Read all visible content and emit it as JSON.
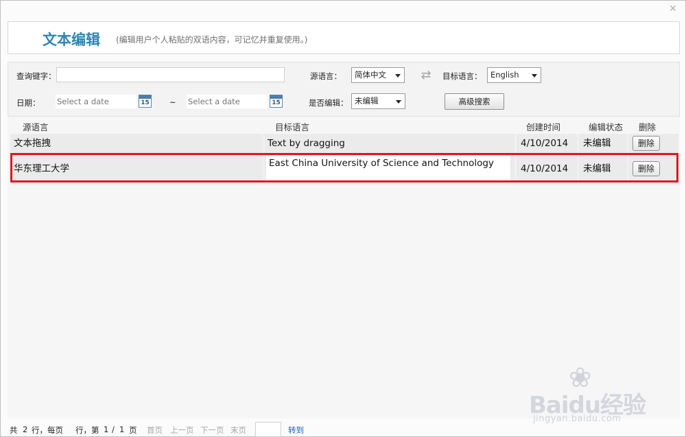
{
  "window": {
    "close_glyph": "✕"
  },
  "header": {
    "title": "文本编辑",
    "subtitle": "(编辑用户个人粘贴的双语内容，可记忆并重复使用。)"
  },
  "search": {
    "keyword_label": "查询键字：",
    "keyword_value": "",
    "source_lang_label": "源语言：",
    "source_lang_value": "简体中文",
    "target_lang_label": "目标语言：",
    "target_lang_value": "English",
    "date_label": "日期：",
    "date_from_placeholder": "Select a date",
    "date_to_placeholder": "Select a date",
    "date_separator": "~",
    "calendar_day": "15",
    "edited_label": "是否编辑：",
    "edited_value": "未编辑",
    "advanced_button": "高级搜索"
  },
  "grid": {
    "columns": [
      "源语言",
      "目标语言",
      "创建时间",
      "编辑状态",
      "删除"
    ],
    "rows": [
      {
        "source": "文本拖拽",
        "target": "Text by dragging",
        "created": "4/10/2014",
        "status": "未编辑",
        "delete": "删除"
      },
      {
        "source": "华东理工大学",
        "target": "East China University of Science and Technology",
        "created": "4/10/2014",
        "status": "未编辑",
        "delete": "删除"
      }
    ]
  },
  "pager": {
    "total_prefix": "共",
    "total_rows": "2",
    "rows_per_page_text": "行，每页",
    "page_prefix": "行，第",
    "current_page": "1",
    "page_sep": "/",
    "total_pages": "1",
    "page_suffix": "页",
    "first": "首页",
    "prev": "上一页",
    "next": "下一页",
    "last": "末页",
    "go": "转到"
  },
  "watermark": {
    "brand": "Baidu经验",
    "url": "jingyan.baidu.com"
  },
  "colors": {
    "title": "#2a86b8",
    "highlight": "#e3141b",
    "pager_link": "#1a5fd0"
  }
}
